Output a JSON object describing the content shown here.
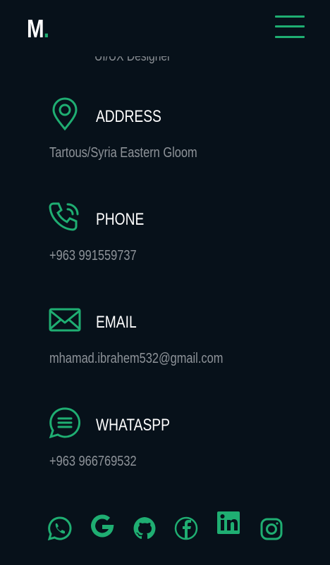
{
  "brand": {
    "logo_letter": "M",
    "logo_dot": "."
  },
  "header": {
    "menu_icon": "hamburger-menu-icon"
  },
  "partial_subtitle": "UI/UX Designer",
  "contacts": [
    {
      "icon": "location-pin-icon",
      "title": "ADDRESS",
      "value": "Tartous/Syria Eastern Gloom"
    },
    {
      "icon": "phone-icon",
      "title": "PHONE",
      "value": "+963 991559737"
    },
    {
      "icon": "email-icon",
      "title": "EMAIL",
      "value": "mhamad.ibrahem532@gmail.com"
    },
    {
      "icon": "chat-bubble-icon",
      "title": "WHATASPP",
      "value": "+963 966769532"
    }
  ],
  "social_links": [
    "whatsapp-icon",
    "google-icon",
    "github-icon",
    "facebook-icon",
    "linkedin-icon",
    "instagram-icon"
  ],
  "colors": {
    "background": "#07111a",
    "accent": "#1fae72",
    "text": "#ffffff",
    "muted": "#8e9399"
  }
}
